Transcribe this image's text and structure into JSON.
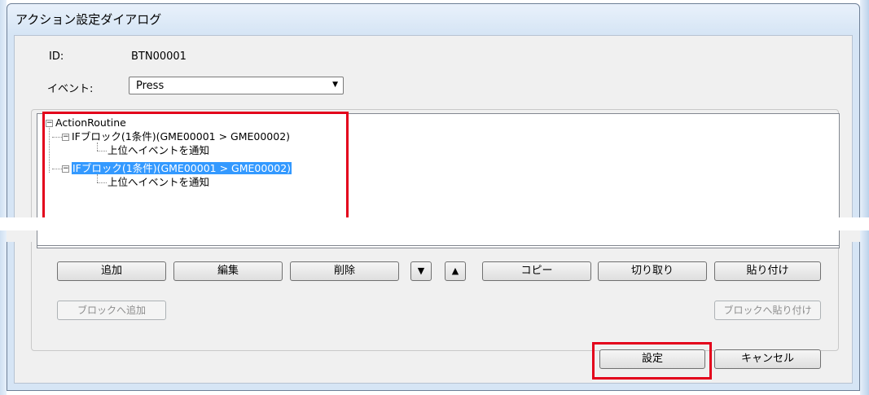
{
  "dialog": {
    "title": "アクション設定ダイアログ"
  },
  "form": {
    "id_label": "ID:",
    "id_value": "BTN00001",
    "event_label": "イベント:",
    "event_selected": "Press"
  },
  "tree": {
    "root": "ActionRoutine",
    "block1": "IFブロック(1条件)(GME00001 > GME00002)",
    "block1_child": "上位へイベントを通知",
    "block2": "IFブロック(1条件)(GME00001 > GME00002)",
    "block2_child": "上位へイベントを通知"
  },
  "buttons": {
    "add": "追加",
    "edit": "編集",
    "delete": "削除",
    "copy": "コピー",
    "cut": "切り取り",
    "paste": "貼り付け",
    "add_to_block": "ブロックへ追加",
    "paste_to_block": "ブロックへ貼り付け",
    "ok": "設定",
    "cancel": "キャンセル"
  },
  "icons": {
    "move_down": "arrow-down-icon",
    "move_up": "arrow-up-icon"
  },
  "colors": {
    "selection": "#3399ff",
    "highlight_box": "#e3001b"
  }
}
